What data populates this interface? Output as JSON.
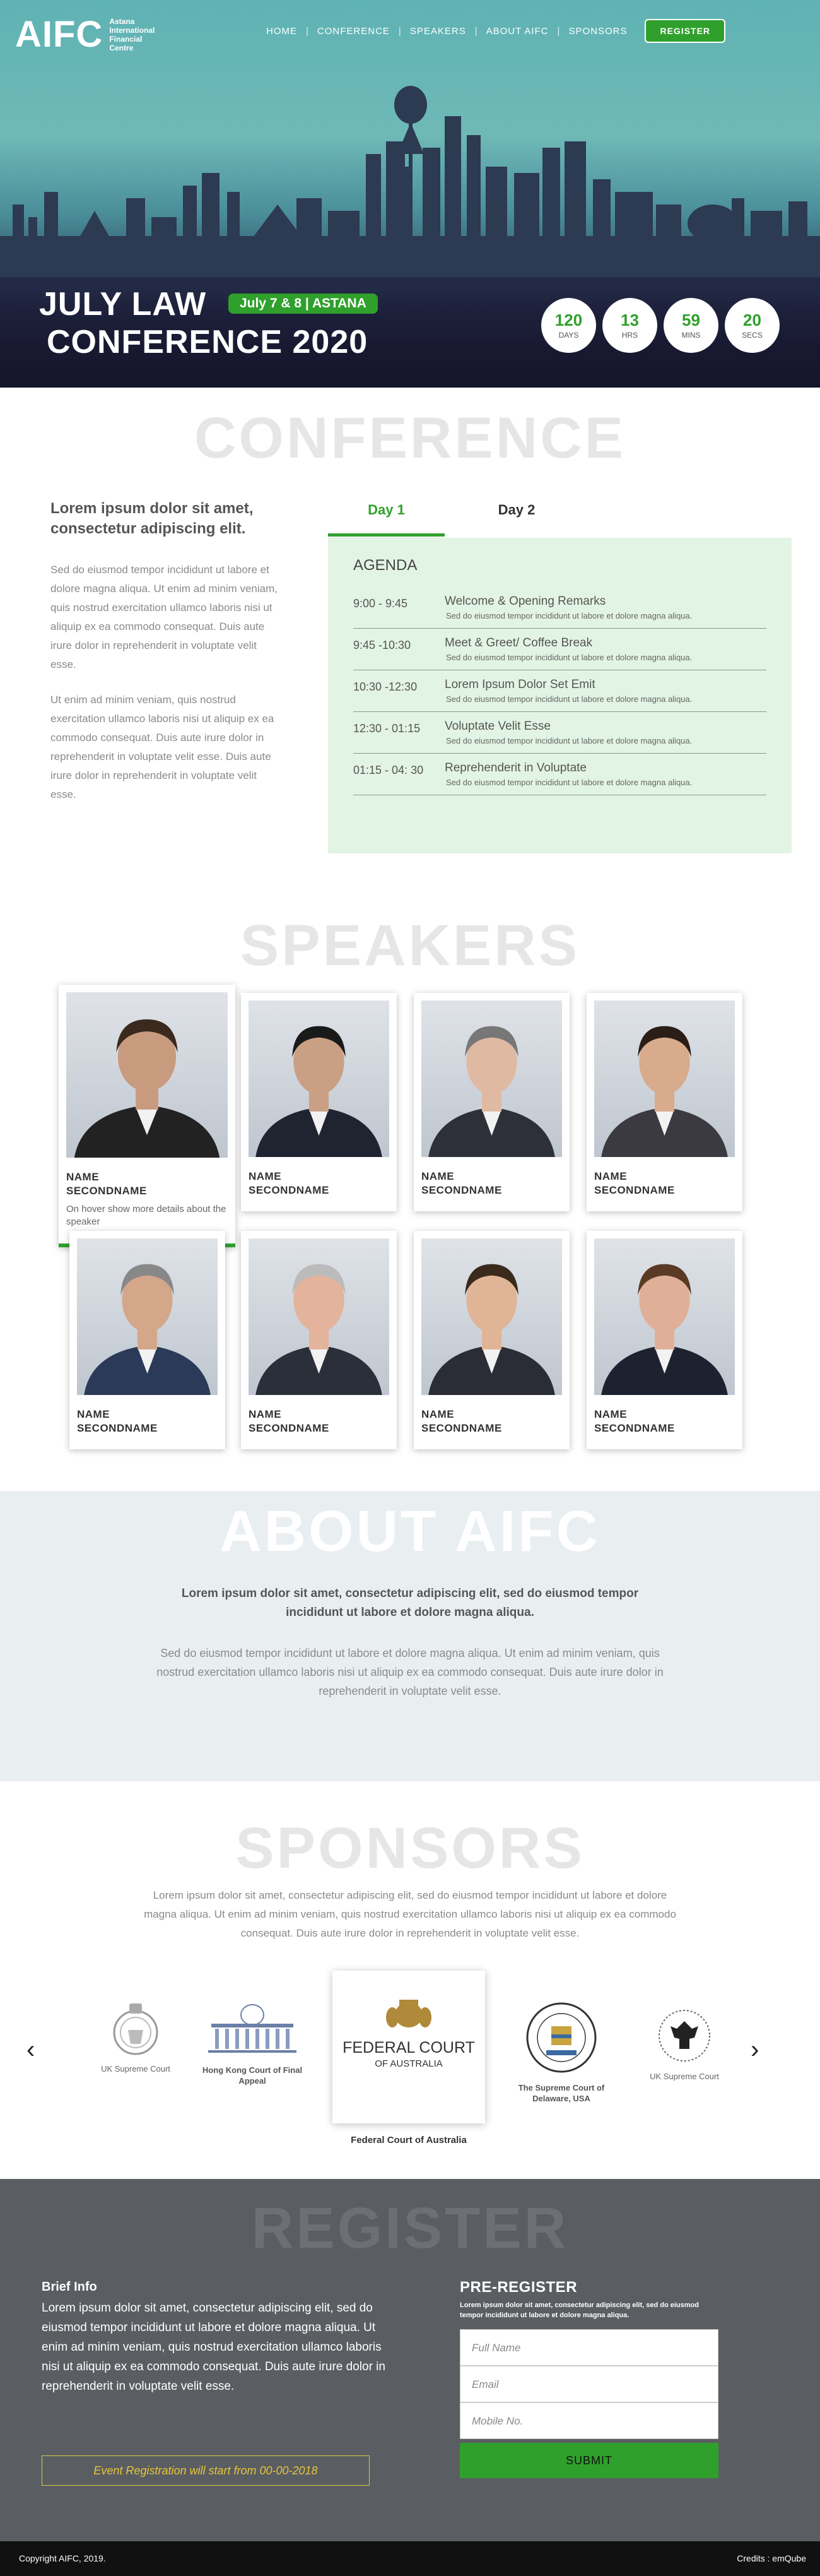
{
  "brand": {
    "logo": "AIFC",
    "logo_sub": "Astana International Financial Centre"
  },
  "nav": {
    "items": [
      "HOME",
      "CONFERENCE",
      "SPEAKERS",
      "ABOUT AIFC",
      "SPONSORS"
    ],
    "register": "REGISTER"
  },
  "hero": {
    "title_line1": "JULY LAW",
    "title_line2": "CONFERENCE 2020",
    "badge": "July 7 & 8  |  ASTANA",
    "countdown": [
      {
        "value": "120",
        "unit": "DAYS"
      },
      {
        "value": "13",
        "unit": "HRS"
      },
      {
        "value": "59",
        "unit": "MINS"
      },
      {
        "value": "20",
        "unit": "SECS"
      }
    ]
  },
  "conference": {
    "title": "CONFERENCE",
    "lead": "Lorem ipsum dolor sit amet, consectetur adipiscing elit.",
    "para1": "Sed do eiusmod tempor incididunt ut labore et dolore magna aliqua. Ut enim ad minim veniam, quis nostrud exercitation ullamco laboris nisi ut aliquip ex ea commodo consequat. Duis aute irure dolor in reprehenderit in voluptate velit esse.",
    "para2": "Ut enim ad minim veniam, quis nostrud exercitation ullamco laboris nisi ut aliquip ex ea commodo consequat. Duis aute irure dolor in reprehenderit in voluptate velit esse. Duis aute irure dolor in reprehenderit in voluptate velit esse.",
    "tabs": [
      "Day 1",
      "Day 2"
    ],
    "agenda_title": "AGENDA",
    "agenda": [
      {
        "time": "9:00 - 9:45",
        "title": "Welcome & Opening Remarks",
        "desc": "Sed do eiusmod tempor incididunt ut labore et dolore magna aliqua."
      },
      {
        "time": "9:45 -10:30",
        "title": "Meet & Greet/ Coffee Break",
        "desc": "Sed do eiusmod tempor incididunt ut labore et dolore magna aliqua."
      },
      {
        "time": "10:30 -12:30",
        "title": "Lorem Ipsum Dolor Set Emit",
        "desc": "Sed do eiusmod tempor incididunt ut labore et dolore magna aliqua."
      },
      {
        "time": "12:30 - 01:15",
        "title": "Voluptate Velit Esse",
        "desc": "Sed do eiusmod tempor incididunt ut labore et dolore magna aliqua."
      },
      {
        "time": "01:15 - 04: 30",
        "title": "Reprehenderit in Voluptate",
        "desc": "Sed do eiusmod tempor incididunt ut labore et dolore magna aliqua."
      }
    ]
  },
  "speakers": {
    "title": "SPEAKERS",
    "name_line1": "NAME",
    "name_line2": "SECONDNAME",
    "hover_note": "On hover show more details about the speaker"
  },
  "about": {
    "title": "ABOUT AIFC",
    "lead": "Lorem ipsum dolor sit amet, consectetur adipiscing elit, sed do eiusmod tempor incididunt ut labore et dolore magna aliqua.",
    "text": "Sed do eiusmod tempor incididunt ut labore et dolore magna aliqua. Ut enim ad minim veniam, quis nostrud exercitation ullamco laboris nisi ut aliquip ex ea commodo consequat. Duis aute irure dolor in reprehenderit in voluptate velit esse."
  },
  "sponsors": {
    "title": "SPONSORS",
    "text": "Lorem ipsum dolor sit amet, consectetur adipiscing elit, sed do eiusmod tempor incididunt ut labore et dolore magna aliqua. Ut enim ad minim veniam, quis nostrud exercitation ullamco laboris nisi ut aliquip ex ea commodo consequat. Duis aute irure dolor in reprehenderit in voluptate velit esse.",
    "items": [
      "UK Supreme Court",
      "Hong Kong Court of Final Appeal",
      "Federal Court of Australia",
      "The Supreme Court of Delaware, USA",
      "UK Supreme Court"
    ],
    "featured_logo_line1": "FEDERAL COURT",
    "featured_logo_line2": "OF AUSTRALIA"
  },
  "register": {
    "title": "REGISTER",
    "brief_title": "Brief Info",
    "brief_text": "Lorem ipsum dolor sit amet, consectetur adipiscing elit, sed do eiusmod tempor incididunt ut labore et dolore magna aliqua. Ut enim ad minim veniam, quis nostrud exercitation ullamco laboris nisi ut aliquip ex ea commodo consequat. Duis aute irure dolor in reprehenderit in voluptate velit esse.",
    "event_note": "Event Registration will start from 00-00-2018",
    "pre_title": "PRE-REGISTER",
    "pre_text": "Lorem ipsum dolor sit amet, consectetur adipiscing elit, sed do eiusmod tempor incididunt ut labore et dolore magna aliqua.",
    "fields": [
      "Full Name",
      "Email",
      "Mobile No."
    ],
    "submit": "SUBMIT"
  },
  "footer": {
    "copyright": "Copyright AIFC, 2019.",
    "credits": "Credits : emQube"
  },
  "colors": {
    "accent": "#2fa02c",
    "dark": "#18182e",
    "register_bg": "#5a5e62"
  }
}
